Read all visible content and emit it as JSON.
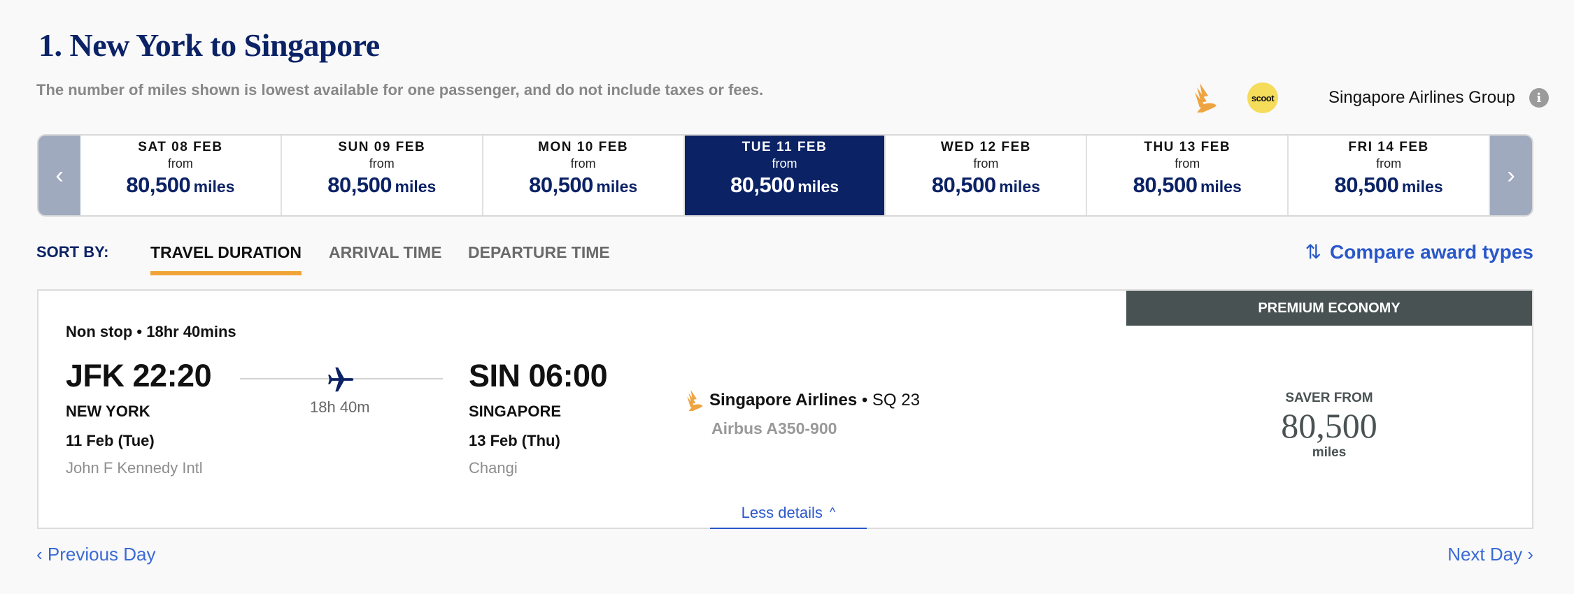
{
  "header": {
    "title": "1. New York to Singapore",
    "subtitle": "The number of miles shown is lowest available for one passenger, and do not include taxes or fees.",
    "airline_group": {
      "logos": [
        "singapore-airlines-logo",
        "scoot-logo"
      ],
      "scoot_text": "scoot",
      "label": "Singapore Airlines Group",
      "info_icon": "i"
    }
  },
  "date_carousel": {
    "prev_icon": "‹",
    "next_icon": "›",
    "dates": [
      {
        "day": "SAT 08 FEB",
        "from": "from",
        "miles": "80,500",
        "unit": "miles",
        "selected": false
      },
      {
        "day": "SUN 09 FEB",
        "from": "from",
        "miles": "80,500",
        "unit": "miles",
        "selected": false
      },
      {
        "day": "MON 10 FEB",
        "from": "from",
        "miles": "80,500",
        "unit": "miles",
        "selected": false
      },
      {
        "day": "TUE 11 FEB",
        "from": "from",
        "miles": "80,500",
        "unit": "miles",
        "selected": true
      },
      {
        "day": "WED 12 FEB",
        "from": "from",
        "miles": "80,500",
        "unit": "miles",
        "selected": false
      },
      {
        "day": "THU 13 FEB",
        "from": "from",
        "miles": "80,500",
        "unit": "miles",
        "selected": false
      },
      {
        "day": "FRI 14 FEB",
        "from": "from",
        "miles": "80,500",
        "unit": "miles",
        "selected": false
      }
    ]
  },
  "sort": {
    "label": "SORT BY:",
    "tabs": [
      {
        "label": "TRAVEL DURATION",
        "active": true
      },
      {
        "label": "ARRIVAL TIME",
        "active": false
      },
      {
        "label": "DEPARTURE TIME",
        "active": false
      }
    ],
    "compare_icon": "⇅",
    "compare_label": "Compare award types"
  },
  "flight": {
    "cabin": "PREMIUM ECONOMY",
    "stops": "Non stop • 18hr 40mins",
    "departure": {
      "time": "JFK 22:20",
      "city": "NEW YORK",
      "date": "11 Feb (Tue)",
      "airport": "John F Kennedy Intl"
    },
    "arrival": {
      "time": "SIN 06:00",
      "city": "SINGAPORE",
      "date": "13 Feb (Thu)",
      "airport": "Changi"
    },
    "duration": "18h 40m",
    "airline": "Singapore Airlines",
    "separator": " • ",
    "flight_no": "SQ 23",
    "aircraft": "Airbus A350-900",
    "price": {
      "label": "SAVER FROM",
      "miles": "80,500",
      "unit": "miles"
    },
    "less_details": "Less details",
    "less_icon": "^"
  },
  "footer": {
    "prev_day": "‹ Previous Day",
    "next_day": "Next Day ›"
  },
  "colors": {
    "brand_navy": "#0b2265",
    "accent_gold": "#f0a437",
    "link_blue": "#2a57c9",
    "cabin_tag": "#485253",
    "arrow_bg": "#9faabf"
  }
}
